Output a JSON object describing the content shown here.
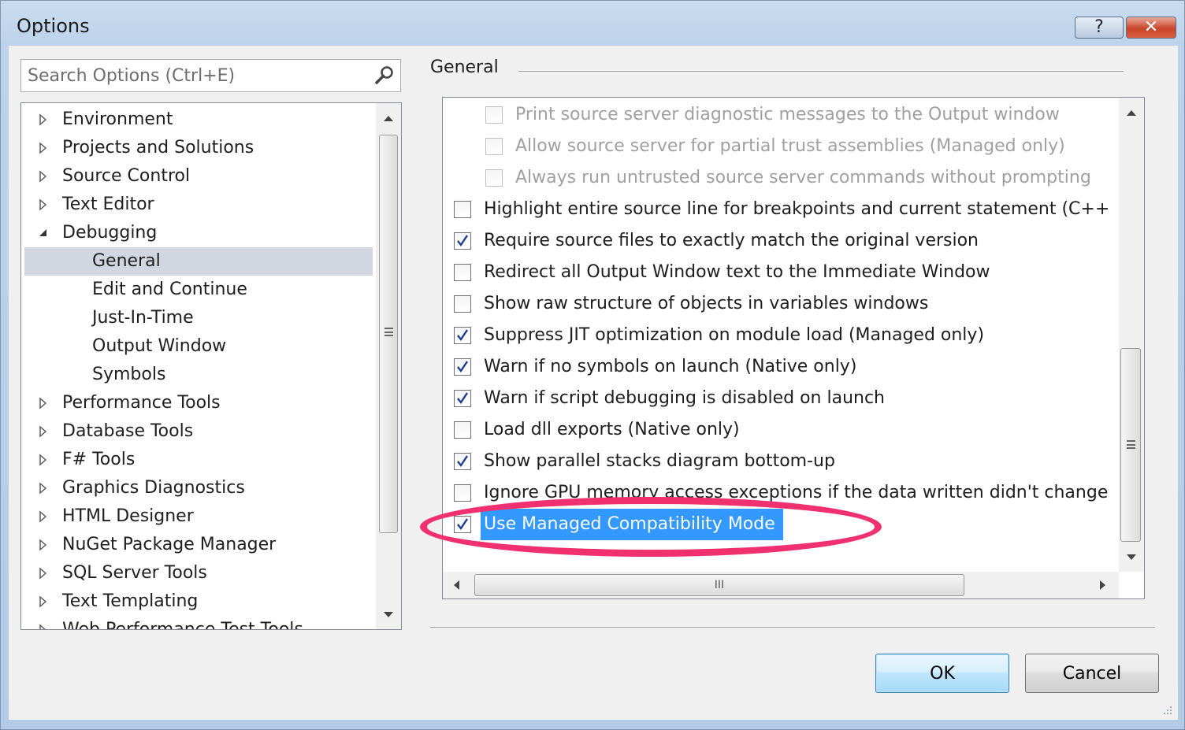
{
  "window": {
    "title": "Options",
    "help_label": "?",
    "close_label": "✕"
  },
  "search": {
    "placeholder": "Search Options (Ctrl+E)"
  },
  "tree": {
    "items": [
      {
        "label": "Environment",
        "level": 0,
        "expander": "collapsed"
      },
      {
        "label": "Projects and Solutions",
        "level": 0,
        "expander": "collapsed"
      },
      {
        "label": "Source Control",
        "level": 0,
        "expander": "collapsed"
      },
      {
        "label": "Text Editor",
        "level": 0,
        "expander": "collapsed"
      },
      {
        "label": "Debugging",
        "level": 0,
        "expander": "expanded"
      },
      {
        "label": "General",
        "level": 1,
        "expander": "none",
        "selected": true
      },
      {
        "label": "Edit and Continue",
        "level": 1,
        "expander": "none"
      },
      {
        "label": "Just-In-Time",
        "level": 1,
        "expander": "none"
      },
      {
        "label": "Output Window",
        "level": 1,
        "expander": "none"
      },
      {
        "label": "Symbols",
        "level": 1,
        "expander": "none"
      },
      {
        "label": "Performance Tools",
        "level": 0,
        "expander": "collapsed"
      },
      {
        "label": "Database Tools",
        "level": 0,
        "expander": "collapsed"
      },
      {
        "label": "F# Tools",
        "level": 0,
        "expander": "collapsed"
      },
      {
        "label": "Graphics Diagnostics",
        "level": 0,
        "expander": "collapsed"
      },
      {
        "label": "HTML Designer",
        "level": 0,
        "expander": "collapsed"
      },
      {
        "label": "NuGet Package Manager",
        "level": 0,
        "expander": "collapsed"
      },
      {
        "label": "SQL Server Tools",
        "level": 0,
        "expander": "collapsed"
      },
      {
        "label": "Text Templating",
        "level": 0,
        "expander": "collapsed"
      },
      {
        "label": "Web Performance Test Tools",
        "level": 0,
        "expander": "collapsed"
      }
    ]
  },
  "section": {
    "label": "General"
  },
  "options": [
    {
      "label": "Print source server diagnostic messages to the Output window",
      "checked": false,
      "disabled": true,
      "indent": 1
    },
    {
      "label": "Allow source server for partial trust assemblies (Managed only)",
      "checked": false,
      "disabled": true,
      "indent": 1
    },
    {
      "label": "Always run untrusted source server commands without prompting",
      "checked": false,
      "disabled": true,
      "indent": 1
    },
    {
      "label": "Highlight entire source line for breakpoints and current statement (C++",
      "checked": false,
      "disabled": false,
      "indent": 0
    },
    {
      "label": "Require source files to exactly match the original version",
      "checked": true,
      "disabled": false,
      "indent": 0
    },
    {
      "label": "Redirect all Output Window text to the Immediate Window",
      "checked": false,
      "disabled": false,
      "indent": 0
    },
    {
      "label": "Show raw structure of objects in variables windows",
      "checked": false,
      "disabled": false,
      "indent": 0
    },
    {
      "label": "Suppress JIT optimization on module load (Managed only)",
      "checked": true,
      "disabled": false,
      "indent": 0
    },
    {
      "label": "Warn if no symbols on launch (Native only)",
      "checked": true,
      "disabled": false,
      "indent": 0
    },
    {
      "label": "Warn if script debugging is disabled on launch",
      "checked": true,
      "disabled": false,
      "indent": 0
    },
    {
      "label": "Load dll exports (Native only)",
      "checked": false,
      "disabled": false,
      "indent": 0
    },
    {
      "label": "Show parallel stacks diagram bottom-up",
      "checked": true,
      "disabled": false,
      "indent": 0
    },
    {
      "label": "Ignore GPU memory access exceptions if the data written didn't change",
      "checked": false,
      "disabled": false,
      "indent": 0
    },
    {
      "label": "Use Managed Compatibility Mode",
      "checked": true,
      "disabled": false,
      "indent": 0,
      "selected": true
    }
  ],
  "buttons": {
    "ok_label": "OK",
    "cancel_label": "Cancel"
  },
  "scroll": {
    "hthumb_label": "III"
  },
  "colors": {
    "selection": "#3399ff",
    "highlight_ellipse": "#f0306f",
    "tree_selection": "#d2d6e1"
  }
}
